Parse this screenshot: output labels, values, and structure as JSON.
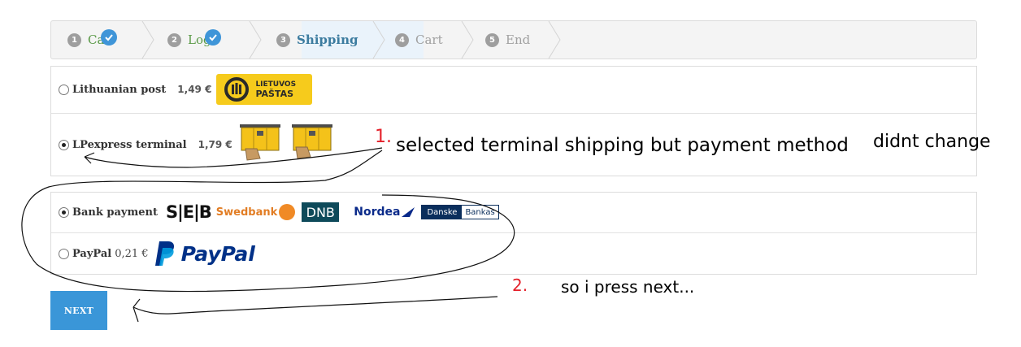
{
  "steps": [
    {
      "num": "1",
      "label": "Car",
      "state": "done"
    },
    {
      "num": "2",
      "label": "Logi",
      "state": "done"
    },
    {
      "num": "3",
      "label": "Shipping",
      "state": "active"
    },
    {
      "num": "4",
      "label": "Cart",
      "state": "pending"
    },
    {
      "num": "5",
      "label": "End",
      "state": "pending"
    }
  ],
  "shipping": [
    {
      "label": "Lithuanian post",
      "price": "1,49 €",
      "selected": false,
      "logo_text_1": "LIETUVOS",
      "logo_text_2": "PAŠTAS"
    },
    {
      "label": "LPexpress terminal",
      "price": "1,79 €",
      "selected": true
    }
  ],
  "payment": [
    {
      "label": "Bank payment",
      "selected": true,
      "banks": {
        "seb": "S|E|B",
        "swedbank": "Swedbank",
        "dnb": "DNB",
        "nordea": "Nordea",
        "danske_1": "Danske",
        "danske_2": "Bankas"
      }
    },
    {
      "label": "PayPal",
      "price": "0,21 €",
      "selected": false,
      "logo_text": "PayPal"
    }
  ],
  "next_label": "NEXT",
  "annotations": {
    "n1": "1.",
    "a1": "selected terminal shipping but payment method",
    "a1b": "didnt change",
    "n2": "2.",
    "a2": "so i press next..."
  },
  "colors": {
    "accent": "#3a96d8",
    "done": "#5a9a47",
    "active": "#3b7b9f",
    "annotation_number": "#e4202a"
  }
}
